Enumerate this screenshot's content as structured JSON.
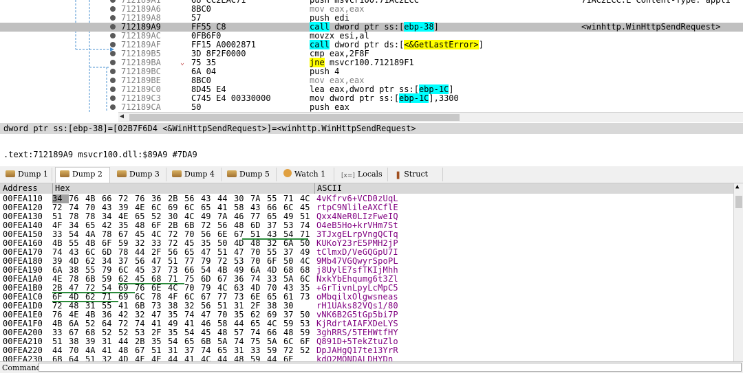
{
  "disasm": {
    "rows": [
      {
        "addr": "712189A1",
        "bytes": "68 CC2EAC71",
        "bytes_u": "CC2EAC71",
        "instr": "push msvcr100.71AC2ECC",
        "comment": "71AC2ECC:L\"Content-Type: appli"
      },
      {
        "addr": "712189A6",
        "bytes": "8BC0",
        "instr": "mov eax,eax",
        "comment": ""
      },
      {
        "addr": "712189A8",
        "bytes": "57",
        "instr": "push edi",
        "comment": ""
      },
      {
        "addr": "712189A9",
        "bytes": "FF55 C8",
        "instr_pre": "call",
        "instr_post": " dword ptr ss:[",
        "instr_mem": "ebp-38",
        "instr_end": "]",
        "comment": "<winhttp.WinHttpSendRequest>"
      },
      {
        "addr": "712189AC",
        "bytes": "0FB6F0",
        "instr": "movzx esi,al",
        "comment": ""
      },
      {
        "addr": "712189AF",
        "bytes": "FF15 A0002871",
        "instr_pre": "call",
        "instr_post": " dword ptr ds:[",
        "instr_mem": "<&GetLastError>",
        "instr_end": "]",
        "comment": ""
      },
      {
        "addr": "712189B5",
        "bytes": "3D 8F2F0000",
        "instr": "cmp eax,2F8F",
        "comment": ""
      },
      {
        "addr": "712189BA",
        "bytes": "75 35",
        "instr_pre": "jne",
        "instr_post": " msvcr100.712189F1",
        "comment": ""
      },
      {
        "addr": "712189BC",
        "bytes": "6A 04",
        "instr": "push 4",
        "comment": ""
      },
      {
        "addr": "712189BE",
        "bytes": "8BC0",
        "instr": "mov eax,eax",
        "comment": ""
      },
      {
        "addr": "712189C0",
        "bytes": "8D45 E4",
        "instr_pre": "lea eax,dword ptr ss:[",
        "instr_mem": "ebp-1C",
        "instr_end": "]",
        "comment": ""
      },
      {
        "addr": "712189C3",
        "bytes": "C745 E4 00330000",
        "instr_pre": "mov dword ptr ss:[",
        "instr_mem": "ebp-1C",
        "instr_end": "],3300",
        "comment": ""
      },
      {
        "addr": "712189CA",
        "bytes": "50",
        "instr": "push eax",
        "comment": ""
      }
    ]
  },
  "info": {
    "line1": "dword ptr ss:[ebp-38]=[02B7F6D4 <&WinHttpSendRequest>]=<winhttp.WinHttpSendRequest>",
    "line2": ".text:712189A9 msvcr100.dll:$89A9 #7DA9"
  },
  "tabs": [
    {
      "label": "Dump 1",
      "icon": "dump-icon"
    },
    {
      "label": "Dump 2",
      "icon": "dump-icon"
    },
    {
      "label": "Dump 3",
      "icon": "dump-icon"
    },
    {
      "label": "Dump 4",
      "icon": "dump-icon"
    },
    {
      "label": "Dump 5",
      "icon": "dump-icon"
    },
    {
      "label": "Watch 1",
      "icon": "watch-icon"
    },
    {
      "label": "Locals",
      "icon": "locals-icon"
    },
    {
      "label": "Struct",
      "icon": "struct-icon"
    }
  ],
  "dump": {
    "headers": {
      "address": "Address",
      "hex": "Hex",
      "ascii": "ASCII"
    },
    "rows": [
      {
        "addr": "00FEA110",
        "hex": [
          "34",
          "76",
          "4B",
          "66",
          "72",
          "76",
          "36",
          "2B",
          "56",
          "43",
          "44",
          "30",
          "7A",
          "55",
          "71",
          "4C"
        ],
        "ascii": "4vKfrv6+VCD0zUqL"
      },
      {
        "addr": "00FEA120",
        "hex": [
          "72",
          "74",
          "70",
          "43",
          "39",
          "4E",
          "6C",
          "69",
          "6C",
          "65",
          "41",
          "58",
          "43",
          "66",
          "6C",
          "45"
        ],
        "ascii": "rtpC9NlileAXCflE"
      },
      {
        "addr": "00FEA130",
        "hex": [
          "51",
          "78",
          "78",
          "34",
          "4E",
          "65",
          "52",
          "30",
          "4C",
          "49",
          "7A",
          "46",
          "77",
          "65",
          "49",
          "51"
        ],
        "ascii": "Qxx4NeR0LIzFweIQ"
      },
      {
        "addr": "00FEA140",
        "hex": [
          "4F",
          "34",
          "65",
          "42",
          "35",
          "48",
          "6F",
          "2B",
          "6B",
          "72",
          "56",
          "48",
          "6D",
          "37",
          "53",
          "74"
        ],
        "ascii": "O4eB5Ho+krVHm7St"
      },
      {
        "addr": "00FEA150",
        "hex": [
          "33",
          "54",
          "4A",
          "78",
          "67",
          "45",
          "4C",
          "72",
          "70",
          "56",
          "6E",
          "67",
          "51",
          "43",
          "54",
          "71"
        ],
        "ascii": "3TJxgELrpVngQCTq"
      },
      {
        "addr": "00FEA160",
        "hex": [
          "4B",
          "55",
          "4B",
          "6F",
          "59",
          "32",
          "33",
          "72",
          "45",
          "35",
          "50",
          "4D",
          "48",
          "32",
          "6A",
          "50"
        ],
        "ascii": "KUKoY23rE5PMH2jP"
      },
      {
        "addr": "00FEA170",
        "hex": [
          "74",
          "43",
          "6C",
          "6D",
          "78",
          "44",
          "2F",
          "56",
          "65",
          "47",
          "51",
          "47",
          "70",
          "55",
          "37",
          "49"
        ],
        "ascii": "tClmxD/VeGQGpU7I"
      },
      {
        "addr": "00FEA180",
        "hex": [
          "39",
          "4D",
          "62",
          "34",
          "37",
          "56",
          "47",
          "51",
          "77",
          "79",
          "72",
          "53",
          "70",
          "6F",
          "50",
          "4C"
        ],
        "ascii": "9Mb47VGQwyrSpoPL"
      },
      {
        "addr": "00FEA190",
        "hex": [
          "6A",
          "38",
          "55",
          "79",
          "6C",
          "45",
          "37",
          "73",
          "66",
          "54",
          "4B",
          "49",
          "6A",
          "4D",
          "68",
          "68"
        ],
        "ascii": "j8UylE7sfTKIjMhh"
      },
      {
        "addr": "00FEA1A0",
        "hex": [
          "4E",
          "78",
          "6B",
          "59",
          "62",
          "45",
          "68",
          "71",
          "75",
          "6D",
          "67",
          "36",
          "74",
          "33",
          "5A",
          "6C"
        ],
        "ascii": "NxkYbEhqumg6t3Zl"
      },
      {
        "addr": "00FEA1B0",
        "hex": [
          "2B",
          "47",
          "72",
          "54",
          "69",
          "76",
          "6E",
          "4C",
          "70",
          "79",
          "4C",
          "63",
          "4D",
          "70",
          "43",
          "35"
        ],
        "ascii": "+GrTivnLpyLcMpC5"
      },
      {
        "addr": "00FEA1C0",
        "hex": [
          "6F",
          "4D",
          "62",
          "71",
          "69",
          "6C",
          "78",
          "4F",
          "6C",
          "67",
          "77",
          "73",
          "6E",
          "65",
          "61",
          "73"
        ],
        "ascii": "oMbqilxOlgwsneas"
      },
      {
        "addr": "00FEA1D0",
        "hex": [
          "72",
          "48",
          "31",
          "55",
          "41",
          "6B",
          "73",
          "38",
          "32",
          "56",
          "51",
          "31",
          "2F",
          "38",
          "30"
        ],
        "ascii": "rH1UAks82VQs1/80"
      },
      {
        "addr": "00FEA1E0",
        "hex": [
          "76",
          "4E",
          "4B",
          "36",
          "42",
          "32",
          "47",
          "35",
          "74",
          "47",
          "70",
          "35",
          "62",
          "69",
          "37",
          "50"
        ],
        "ascii": "vNK6B2G5tGp5bi7P"
      },
      {
        "addr": "00FEA1F0",
        "hex": [
          "4B",
          "6A",
          "52",
          "64",
          "72",
          "74",
          "41",
          "49",
          "41",
          "46",
          "58",
          "44",
          "65",
          "4C",
          "59",
          "53"
        ],
        "ascii": "KjRdrtAIAFXDeLYS"
      },
      {
        "addr": "00FEA200",
        "hex": [
          "33",
          "67",
          "68",
          "52",
          "52",
          "53",
          "2F",
          "35",
          "54",
          "45",
          "48",
          "57",
          "74",
          "66",
          "48",
          "59"
        ],
        "ascii": "3ghRRS/5TEHWtfHY"
      },
      {
        "addr": "00FEA210",
        "hex": [
          "51",
          "38",
          "39",
          "31",
          "44",
          "2B",
          "35",
          "54",
          "65",
          "6B",
          "5A",
          "74",
          "75",
          "5A",
          "6C",
          "6F"
        ],
        "ascii": "Q891D+5TekZtuZlo"
      },
      {
        "addr": "00FEA220",
        "hex": [
          "44",
          "70",
          "4A",
          "41",
          "48",
          "67",
          "51",
          "31",
          "37",
          "74",
          "65",
          "31",
          "33",
          "59",
          "72",
          "52"
        ],
        "ascii": "DpJAHgQ17te13YrR"
      },
      {
        "addr": "00FEA230",
        "hex": [
          "6B",
          "64",
          "51",
          "32",
          "4D",
          "4F",
          "4E",
          "44",
          "41",
          "4C",
          "44",
          "48",
          "59",
          "44",
          "6E"
        ],
        "ascii": "kdQ2MONDALDHYDn"
      }
    ]
  },
  "command": {
    "label": "Command:",
    "value": ""
  }
}
